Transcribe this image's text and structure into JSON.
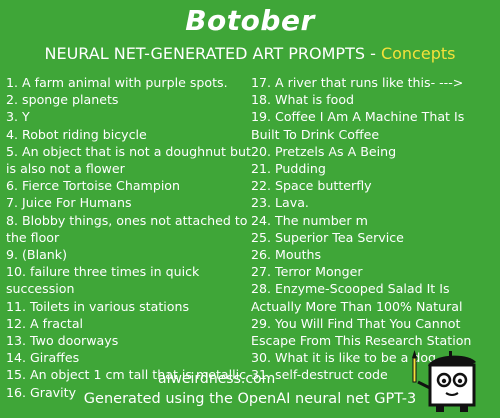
{
  "header": {
    "title": "Botober",
    "subtitle_main": "NEURAL NET-GENERATED ART PROMPTS - ",
    "subtitle_accent": "Concepts"
  },
  "colors": {
    "background": "#3fa638",
    "text": "#ffffff",
    "accent": "#f4e13a"
  },
  "prompts_left": [
    "1. A farm animal with purple spots.",
    "2. sponge planets",
    "3. Y",
    "4. Robot riding bicycle",
    "5. An object that is not a doughnut but is also not a flower",
    "6. Fierce Tortoise Champion",
    "7. Juice For Humans",
    "8. Blobby things, ones not attached to the floor",
    "9. (Blank)",
    "10. failure three times in quick succession",
    "11. Toilets in various stations",
    "12. A fractal",
    "13. Two doorways",
    "14. Giraffes",
    "15. An object 1 cm tall that is metallic",
    "16. Gravity"
  ],
  "prompts_right": [
    "17. A river that runs like this- --->",
    "18. What is food",
    "19. Coffee I Am A Machine That Is Built To Drink Coffee",
    "20. Pretzels As A Being",
    "21. Pudding",
    "22. Space butterfly",
    "23. Lava.",
    "24. The number m",
    "25. Superior Tea Service",
    "26. Mouths",
    "27. Terror Monger",
    "28. Enzyme-Scooped Salad It Is Actually More Than 100% Natural",
    "29. You Will Find That You Cannot Escape From This Research Station",
    "30. What it is like to be a dog.",
    "31. self-destruct code"
  ],
  "site": "aiweirdness.com",
  "footer": "Generated using the OpenAI neural net GPT-3",
  "illustration": "robot-artist-icon"
}
